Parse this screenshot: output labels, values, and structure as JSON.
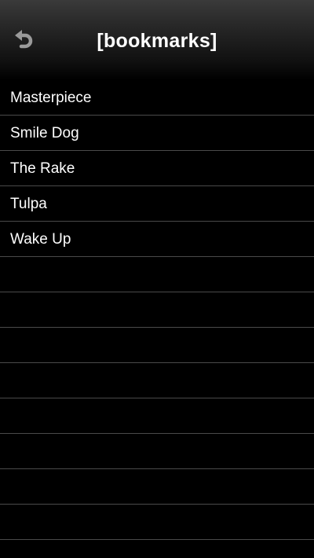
{
  "header": {
    "title": "[bookmarks]",
    "back_icon": "undo-arrow-icon"
  },
  "colors": {
    "background": "#000000",
    "text": "#ffffff",
    "separator": "#4a4a4a",
    "icon": "#9a9a9a"
  },
  "bookmarks": [
    {
      "label": "Masterpiece"
    },
    {
      "label": "Smile Dog"
    },
    {
      "label": "The Rake"
    },
    {
      "label": "Tulpa"
    },
    {
      "label": "Wake Up"
    }
  ]
}
